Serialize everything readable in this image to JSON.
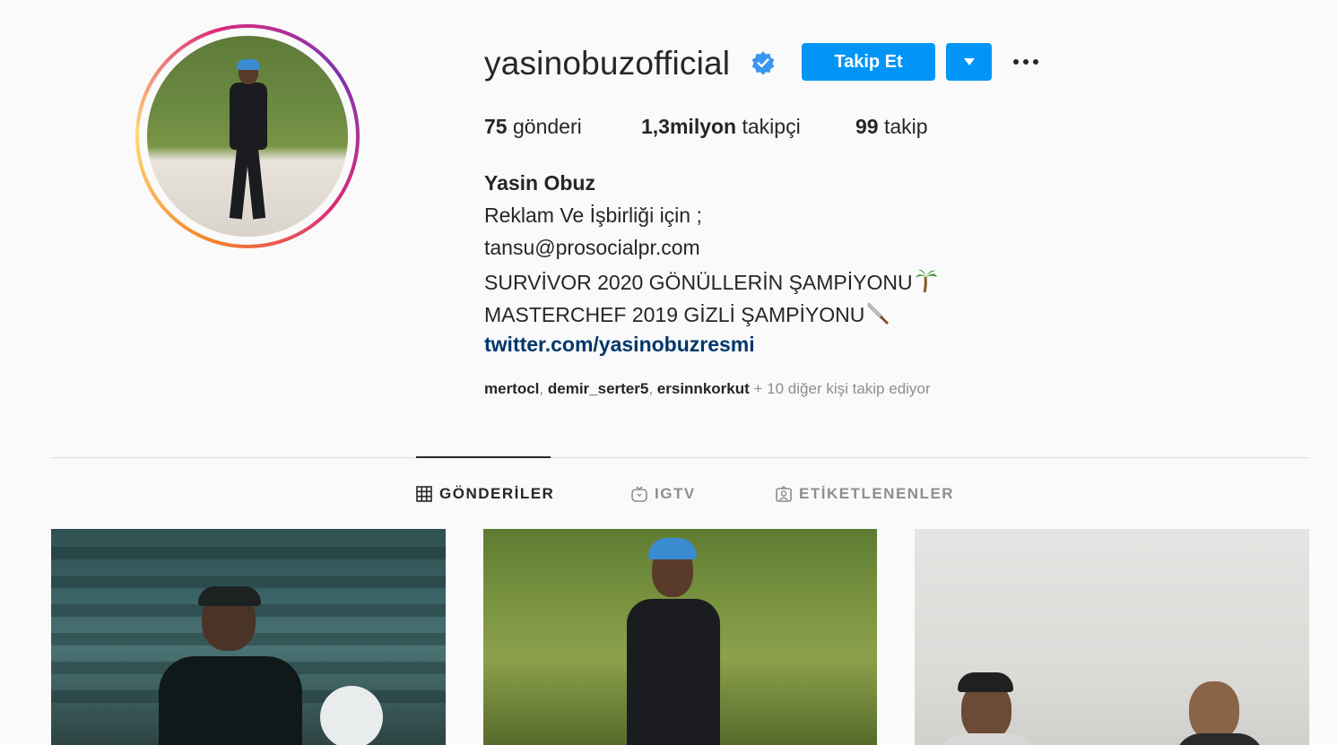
{
  "profile": {
    "username": "yasinobuzofficial",
    "verified_icon": "verified-badge-icon",
    "follow_label": "Takip Et",
    "stats": {
      "posts_count": "75",
      "posts_label": "gönderi",
      "followers_count": "1,3milyon",
      "followers_label": "takipçi",
      "following_count": "99",
      "following_label": "takip"
    },
    "bio": {
      "name": "Yasin Obuz",
      "line1": "Reklam Ve İşbirliği için ;",
      "line2": "tansu@prosocialpr.com",
      "line3": "SURVİVOR 2020 GÖNÜLLERİN ŞAMPİYONU",
      "line4": "MASTERCHEF 2019 GİZLİ ŞAMPİYONU",
      "link": "twitter.com/yasinobuzresmi"
    },
    "followed_by": {
      "users": [
        "mertocl",
        "demir_serter5",
        "ersinnkorkut"
      ],
      "rest": "+ 10 diğer kişi takip ediyor"
    }
  },
  "tabs": {
    "posts": "GÖNDERİLER",
    "igtv": "IGTV",
    "tagged": "ETİKETLENENLER"
  },
  "colors": {
    "accent": "#0095f6",
    "link": "#00376b",
    "muted": "#8e8e8e",
    "text": "#262626",
    "background": "#fafafa"
  }
}
